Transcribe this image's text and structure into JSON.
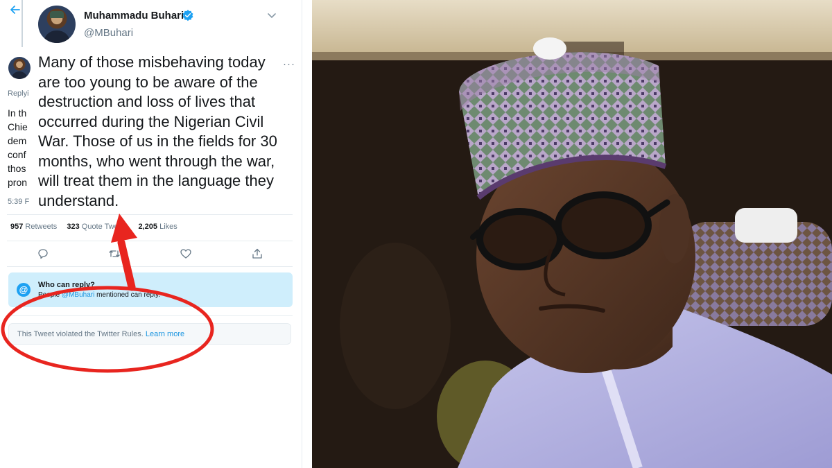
{
  "tweet": {
    "display_name": "Muhammadu Buhari",
    "handle": "@MBuhari",
    "body": "Many of those misbehaving today are too young to be aware of the destruction and loss of lives that occurred during the Nigerian Civil War. Those of us in the fields for 30 months, who went through the war, will treat them in the language they understand.",
    "more_glyph": "···",
    "stats": [
      {
        "count": "957",
        "label": "Retweets"
      },
      {
        "count": "323",
        "label": "Quote Tweets"
      },
      {
        "count": "2,205",
        "label": "Likes"
      }
    ],
    "actions": [
      "reply-icon",
      "retweet-icon",
      "like-icon",
      "share-icon"
    ]
  },
  "previous_tweet": {
    "reply_fragment": "Replyi",
    "lines": [
      "In th",
      "Chie",
      "dem",
      "conf",
      "thos",
      "pron"
    ],
    "time_fragment": "5:39 F"
  },
  "who_can_reply": {
    "title": "Who can reply?",
    "desc_before": "People ",
    "mention": "@MBuhari",
    "desc_after": " mentioned can reply."
  },
  "violation": {
    "text": "This Tweet violated the Twitter Rules. ",
    "link": "Learn more"
  },
  "annotation": {
    "color": "#e8251f"
  },
  "colors": {
    "twitter_blue": "#1da1f2",
    "reply_box_bg": "#cfeefc",
    "muted_text": "#657786",
    "annotation_red": "#e8251f"
  },
  "photo": {
    "subject": "portrait photo of man in patterned cap and glasses"
  }
}
